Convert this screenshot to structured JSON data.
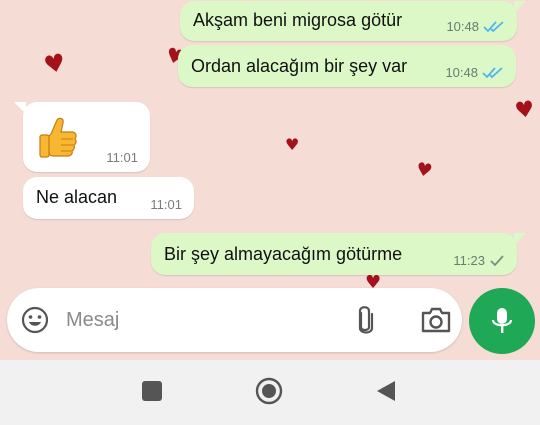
{
  "messages": [
    {
      "dir": "out",
      "text": "Akşam beni migrosa götür",
      "time": "10:48",
      "status": "read"
    },
    {
      "dir": "out",
      "text": "Ordan alacağım bir şey var",
      "time": "10:48",
      "status": "read"
    },
    {
      "dir": "in",
      "emoji": "thumbs-up",
      "time": "11:01"
    },
    {
      "dir": "in",
      "text": "Ne alacan",
      "time": "11:01"
    },
    {
      "dir": "out",
      "text": "Bir şey almayacağım götürme",
      "time": "11:23",
      "status": "sent"
    }
  ],
  "composer": {
    "placeholder": "Mesaj"
  },
  "colors": {
    "outgoing": "#dcf8c6",
    "incoming": "#ffffff",
    "wallpaper": "#f5dcd5",
    "read_tick": "#4fb6ec",
    "accent": "#1fa855",
    "heart": "#a5111b"
  },
  "icons": [
    "emoji-icon",
    "attach-icon",
    "camera-icon",
    "mic-icon",
    "nav-square-icon",
    "nav-home-icon",
    "nav-back-icon"
  ]
}
